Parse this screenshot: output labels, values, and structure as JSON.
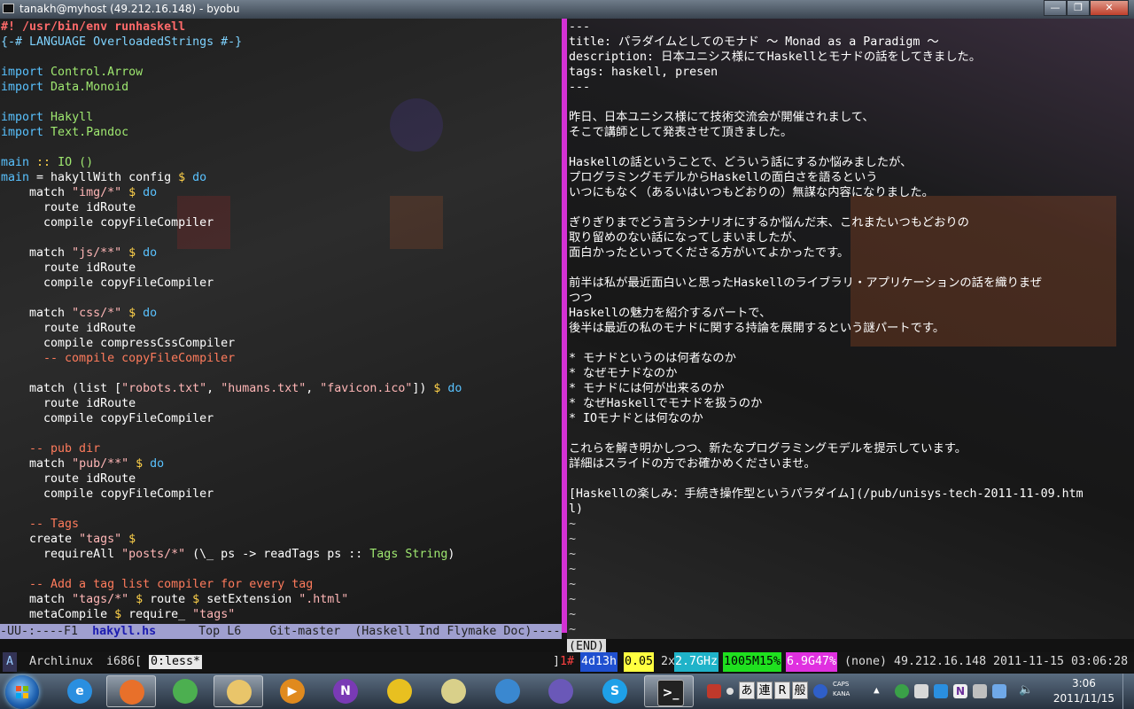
{
  "window": {
    "title": "tanakh@myhost (49.212.16.148) - byobu",
    "buttons": {
      "minimize": "—",
      "maximize": "❐",
      "close": "✕"
    }
  },
  "editor_left": {
    "lines": [
      [
        {
          "t": "#! /usr/bin/env runhaskell",
          "c": "shebang"
        }
      ],
      [
        {
          "t": "{-# LANGUAGE OverloadedStrings #-}",
          "c": "pragma"
        }
      ],
      [],
      [
        {
          "t": "import",
          "c": "kw"
        },
        {
          "t": " Control.Arrow",
          "c": "type"
        }
      ],
      [
        {
          "t": "import",
          "c": "kw"
        },
        {
          "t": " Data.Monoid",
          "c": "type"
        }
      ],
      [],
      [
        {
          "t": "import",
          "c": "kw"
        },
        {
          "t": " Hakyll",
          "c": "type"
        }
      ],
      [
        {
          "t": "import",
          "c": "kw"
        },
        {
          "t": " Text.Pandoc",
          "c": "type"
        }
      ],
      [],
      [
        {
          "t": "main",
          "c": "kw"
        },
        {
          "t": " :: ",
          "c": "op"
        },
        {
          "t": "IO ()",
          "c": "type"
        }
      ],
      [
        {
          "t": "main",
          "c": "kw"
        },
        {
          "t": " = hakyllWith config ",
          "c": "plain"
        },
        {
          "t": "$",
          "c": "op"
        },
        {
          "t": " do",
          "c": "kw"
        }
      ],
      [
        {
          "t": "    match ",
          "c": "plain"
        },
        {
          "t": "\"img/*\"",
          "c": "str"
        },
        {
          "t": " $",
          "c": "op"
        },
        {
          "t": " do",
          "c": "kw"
        }
      ],
      [
        {
          "t": "      route idRoute",
          "c": "plain"
        }
      ],
      [
        {
          "t": "      compile copyFileCompiler",
          "c": "plain"
        }
      ],
      [],
      [
        {
          "t": "    match ",
          "c": "plain"
        },
        {
          "t": "\"js/**\"",
          "c": "str"
        },
        {
          "t": " $",
          "c": "op"
        },
        {
          "t": " do",
          "c": "kw"
        }
      ],
      [
        {
          "t": "      route idRoute",
          "c": "plain"
        }
      ],
      [
        {
          "t": "      compile copyFileCompiler",
          "c": "plain"
        }
      ],
      [],
      [
        {
          "t": "    match ",
          "c": "plain"
        },
        {
          "t": "\"css/*\"",
          "c": "str"
        },
        {
          "t": " $",
          "c": "op"
        },
        {
          "t": " do",
          "c": "kw"
        }
      ],
      [
        {
          "t": "      route idRoute",
          "c": "plain"
        }
      ],
      [
        {
          "t": "      compile compressCssCompiler",
          "c": "plain"
        }
      ],
      [
        {
          "t": "      -- compile copyFileCompiler",
          "c": "comment"
        }
      ],
      [],
      [
        {
          "t": "    match (list [",
          "c": "plain"
        },
        {
          "t": "\"robots.txt\"",
          "c": "str"
        },
        {
          "t": ", ",
          "c": "plain"
        },
        {
          "t": "\"humans.txt\"",
          "c": "str"
        },
        {
          "t": ", ",
          "c": "plain"
        },
        {
          "t": "\"favicon.ico\"",
          "c": "str"
        },
        {
          "t": "])",
          "c": "plain"
        },
        {
          "t": " $",
          "c": "op"
        },
        {
          "t": " do",
          "c": "kw"
        }
      ],
      [
        {
          "t": "      route idRoute",
          "c": "plain"
        }
      ],
      [
        {
          "t": "      compile copyFileCompiler",
          "c": "plain"
        }
      ],
      [],
      [
        {
          "t": "    -- pub dir",
          "c": "comment"
        }
      ],
      [
        {
          "t": "    match ",
          "c": "plain"
        },
        {
          "t": "\"pub/**\"",
          "c": "str"
        },
        {
          "t": " $",
          "c": "op"
        },
        {
          "t": " do",
          "c": "kw"
        }
      ],
      [
        {
          "t": "      route idRoute",
          "c": "plain"
        }
      ],
      [
        {
          "t": "      compile copyFileCompiler",
          "c": "plain"
        }
      ],
      [],
      [
        {
          "t": "    -- Tags",
          "c": "comment"
        }
      ],
      [
        {
          "t": "    create ",
          "c": "plain"
        },
        {
          "t": "\"tags\"",
          "c": "str"
        },
        {
          "t": " $",
          "c": "op"
        }
      ],
      [
        {
          "t": "      requireAll ",
          "c": "plain"
        },
        {
          "t": "\"posts/*\"",
          "c": "str"
        },
        {
          "t": " (\\_ ps -> readTags ps :: ",
          "c": "plain"
        },
        {
          "t": "Tags String",
          "c": "type"
        },
        {
          "t": ")",
          "c": "plain"
        }
      ],
      [],
      [
        {
          "t": "    -- Add a tag list compiler for every tag",
          "c": "comment"
        }
      ],
      [
        {
          "t": "    match ",
          "c": "plain"
        },
        {
          "t": "\"tags/*\"",
          "c": "str"
        },
        {
          "t": " $",
          "c": "op"
        },
        {
          "t": " route ",
          "c": "plain"
        },
        {
          "t": "$",
          "c": "op"
        },
        {
          "t": " setExtension ",
          "c": "plain"
        },
        {
          "t": "\".html\"",
          "c": "str"
        }
      ],
      [
        {
          "t": "    metaCompile ",
          "c": "plain"
        },
        {
          "t": "$",
          "c": "op"
        },
        {
          "t": " require_ ",
          "c": "plain"
        },
        {
          "t": "\"tags\"",
          "c": "str"
        }
      ]
    ],
    "modeline": {
      "prefix": "-UU-:----F1  ",
      "buffer": "hakyll.hs",
      "rest": "      Top L6    Git-master  (Haskell Ind Flymake Doc)----"
    }
  },
  "pager_right": {
    "lines": [
      "---",
      "title: パラダイムとしてのモナド 〜 Monad as a Paradigm 〜",
      "description: 日本ユニシス様にてHaskellとモナドの話をしてきました。",
      "tags: haskell, presen",
      "---",
      "",
      "昨日、日本ユニシス様にて技術交流会が開催されまして、",
      "そこで講師として発表させて頂きました。",
      "",
      "Haskellの話ということで、どういう話にするか悩みましたが、",
      "プログラミングモデルからHaskellの面白さを語るという",
      "いつにもなく（あるいはいつもどおりの）無謀な内容になりました。",
      "",
      "ぎりぎりまでどう言うシナリオにするか悩んだ末、これまたいつもどおりの",
      "取り留めのない話になってしまいましたが、",
      "面白かったといってくださる方がいてよかったです。",
      "",
      "前半は私が最近面白いと思ったHaskellのライブラリ・アプリケーションの話を織りまぜ",
      "つつ",
      "Haskellの魅力を紹介するパートで、",
      "後半は最近の私のモナドに関する持論を展開するという謎パートです。",
      "",
      "* モナドというのは何者なのか",
      "* なぜモナドなのか",
      "* モナドには何が出来るのか",
      "* なぜHaskellでモナドを扱うのか",
      "* IOモナドとは何なのか",
      "",
      "これらを解き明かしつつ、新たなプログラミングモデルを提示しています。",
      "詳細はスライドの方でお確かめくださいませ。",
      "",
      "[Haskellの楽しみ：手続き操作型というパラダイム](/pub/unisys-tech-2011-11-09.htm",
      "l)",
      "~",
      "~",
      "~",
      "~",
      "~",
      "~",
      "~",
      "~"
    ],
    "end_marker": "(END)"
  },
  "byobu": {
    "logo": "A",
    "distro": "Archlinux",
    "arch": "i686[",
    "window": "0:less*",
    "bracket": "]",
    "uptime_prefix": "1#",
    "uptime": "4d13h",
    "load": "0.05",
    "cpu_count": "2x",
    "cpu_freq": "2.7GHz",
    "mem": "1005M15%",
    "disk": "6.9G47%",
    "network": "(none)",
    "ip": "49.212.16.148",
    "datetime": "2011-11-15 03:06:28"
  },
  "taskbar": {
    "apps": [
      {
        "name": "internet-explorer-icon",
        "color": "#2a8fe0",
        "glyph": "e"
      },
      {
        "name": "firefox-icon",
        "color": "#e8702a",
        "glyph": ""
      },
      {
        "name": "chrome-icon",
        "color": "#4caf50",
        "glyph": ""
      },
      {
        "name": "file-explorer-icon",
        "color": "#e9c56a",
        "glyph": ""
      },
      {
        "name": "media-player-icon",
        "color": "#e08a1e",
        "glyph": "▶"
      },
      {
        "name": "onenote-icon",
        "color": "#7a3ab5",
        "glyph": "N"
      },
      {
        "name": "network-manager-icon",
        "color": "#e8c020",
        "glyph": ""
      },
      {
        "name": "notepad-icon",
        "color": "#d9d08a",
        "glyph": ""
      },
      {
        "name": "globe-icon",
        "color": "#3a88d0",
        "glyph": ""
      },
      {
        "name": "eclipse-icon",
        "color": "#6a58b8",
        "glyph": ""
      },
      {
        "name": "skype-icon",
        "color": "#1ea0e8",
        "glyph": "S"
      },
      {
        "name": "terminal-icon",
        "color": "#222222",
        "glyph": ">_"
      }
    ],
    "ime": {
      "mode": "あ",
      "kanji": "連",
      "r": "R",
      "han": "般"
    },
    "caps": "CAPS",
    "kana": "KANA",
    "clock_time": "3:06",
    "clock_date": "2011/11/15"
  }
}
